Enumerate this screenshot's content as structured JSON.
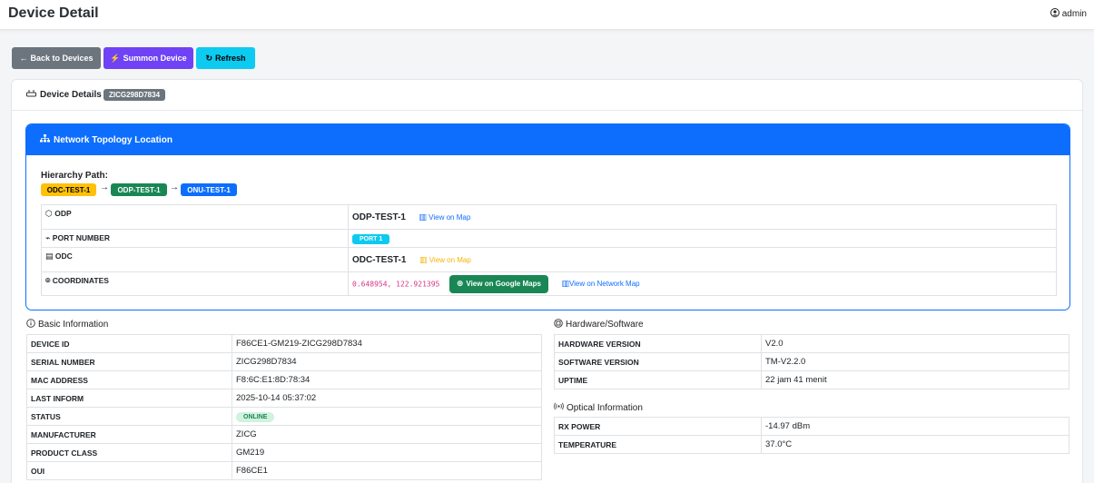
{
  "header": {
    "title": "Device Detail",
    "user": "admin"
  },
  "toolbar": {
    "back_label": "Back to Devices",
    "summon_label": "Summon Device",
    "refresh_label": "Refresh"
  },
  "device_card": {
    "title": "Device Details",
    "id_badge": "ZICG298D7834"
  },
  "topology": {
    "title": "Network Topology Location",
    "hierarchy_label": "Hierarchy Path:",
    "path": [
      "ODC-TEST-1",
      "ODP-TEST-1",
      "ONU-TEST-1"
    ],
    "path_colors": [
      "#ffc107",
      "#198754",
      "#0d6efd"
    ],
    "rows": {
      "odp": {
        "label": "ODP",
        "value": "ODP-TEST-1",
        "link": "View on Map"
      },
      "port": {
        "label": "PORT NUMBER",
        "value": "PORT 1"
      },
      "odc": {
        "label": "ODC",
        "value": "ODC-TEST-1",
        "link": "View on Map"
      },
      "coords": {
        "label": "COORDINATES",
        "value": "0.648954, 122.921395",
        "gmaps": "View on Google Maps",
        "netmap": "View on Network Map"
      }
    }
  },
  "basic": {
    "title": "Basic Information",
    "rows": [
      {
        "k": "DEVICE ID",
        "v": "F86CE1-GM219-ZICG298D7834"
      },
      {
        "k": "SERIAL NUMBER",
        "v": "ZICG298D7834"
      },
      {
        "k": "MAC ADDRESS",
        "v": "F8:6C:E1:8D:78:34"
      },
      {
        "k": "LAST INFORM",
        "v": "2025-10-14 05:37:02"
      },
      {
        "k": "STATUS",
        "v": "ONLINE"
      },
      {
        "k": "MANUFACTURER",
        "v": "ZICG"
      },
      {
        "k": "PRODUCT CLASS",
        "v": "GM219"
      },
      {
        "k": "OUI",
        "v": "F86CE1"
      }
    ]
  },
  "hardware": {
    "title": "Hardware/Software",
    "rows": [
      {
        "k": "HARDWARE VERSION",
        "v": "V2.0"
      },
      {
        "k": "SOFTWARE VERSION",
        "v": "TM-V2.2.0"
      },
      {
        "k": "UPTIME",
        "v": "22 jam 41 menit"
      }
    ]
  },
  "optical": {
    "title": "Optical Information",
    "rows": [
      {
        "k": "RX POWER",
        "v": "-14.97 dBm"
      },
      {
        "k": "TEMPERATURE",
        "v": "37.0°C"
      }
    ]
  }
}
